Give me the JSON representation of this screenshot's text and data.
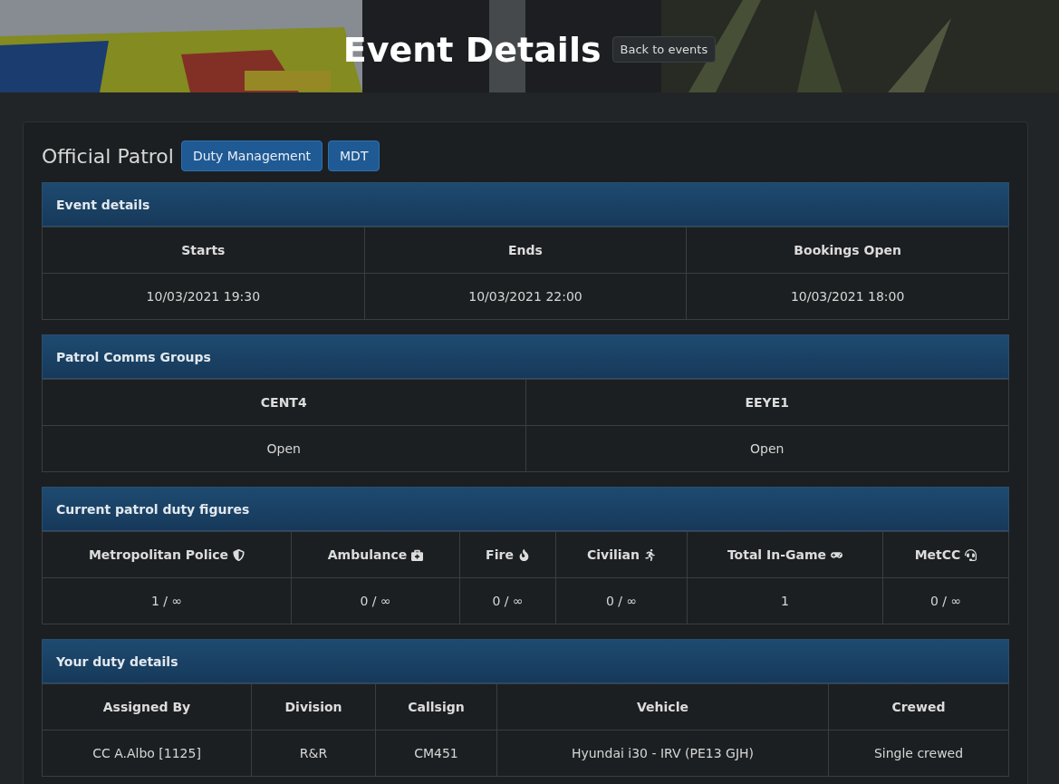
{
  "header": {
    "title": "Event Details",
    "back_button": "Back to events"
  },
  "event": {
    "title": "Official Patrol",
    "buttons": [
      "Duty Management",
      "MDT"
    ]
  },
  "sections": [
    {
      "kind": "plain",
      "title": "Event details",
      "columns": [
        "Starts",
        "Ends",
        "Bookings Open"
      ],
      "rows": [
        [
          "10/03/2021 19:30",
          "10/03/2021 22:00",
          "10/03/2021 18:00"
        ]
      ]
    },
    {
      "kind": "plain",
      "title": "Patrol Comms Groups",
      "columns": [
        "CENT4",
        "EEYE1"
      ],
      "rows": [
        [
          "Open",
          "Open"
        ]
      ]
    },
    {
      "kind": "figures",
      "title": "Current patrol duty figures",
      "columns": [
        "Metropolitan Police",
        "Ambulance",
        "Fire",
        "Civilian",
        "Total In-Game",
        "MetCC"
      ],
      "rows": [
        [
          "1 / ∞",
          "0 / ∞",
          "0 / ∞",
          "0 / ∞",
          "1",
          "0 / ∞"
        ]
      ]
    },
    {
      "kind": "plain",
      "title": "Your duty details",
      "columns": [
        "Assigned By",
        "Division",
        "Callsign",
        "Vehicle",
        "Crewed"
      ],
      "rows": [
        [
          "CC A.Albo [1125]",
          "R&R",
          "CM451",
          "Hyundai i30 - IRV (PE13 GJH)",
          "Single crewed"
        ]
      ]
    }
  ]
}
